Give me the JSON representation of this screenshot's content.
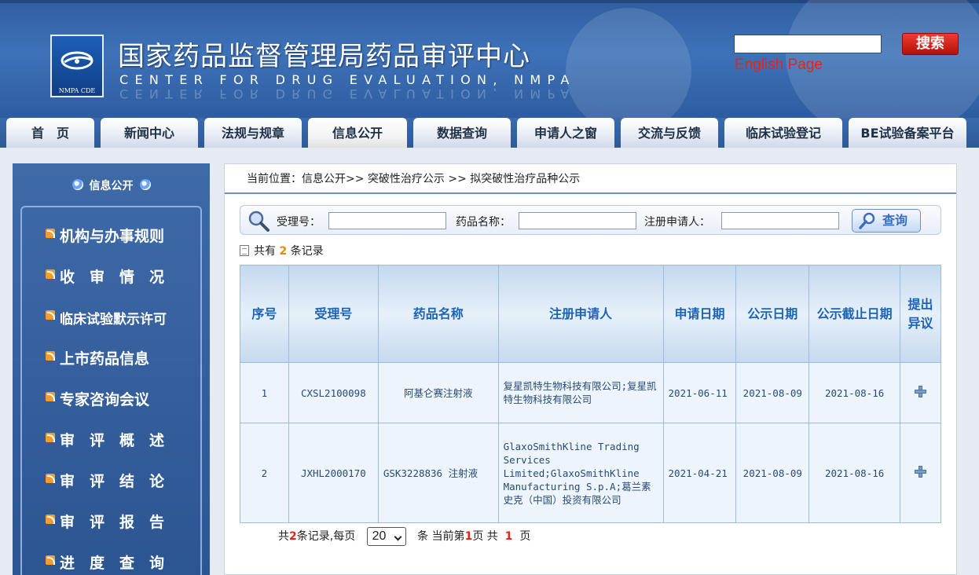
{
  "header": {
    "title": "国家药品监督管理局药品审评中心",
    "subtitle": "CENTER FOR DRUG EVALUATION, NMPA",
    "logo_caption": "NMPA CDE",
    "search_button": "搜索",
    "english_link": "English Page"
  },
  "nav": {
    "tabs": [
      {
        "label": "首　页"
      },
      {
        "label": "新闻中心"
      },
      {
        "label": "法规与规章"
      },
      {
        "label": "信息公开",
        "active": true
      },
      {
        "label": "数据查询"
      },
      {
        "label": "申请人之窗"
      },
      {
        "label": "交流与反馈"
      },
      {
        "label": "临床试验登记"
      },
      {
        "label": "BE试验备案平台"
      }
    ]
  },
  "sidebar": {
    "title": "信息公开",
    "items": [
      {
        "label": "机构与办事规则"
      },
      {
        "label": "收　审　情　况"
      },
      {
        "label": "临床试验默示许可"
      },
      {
        "label": "上市药品信息"
      },
      {
        "label": "专家咨询会议"
      },
      {
        "label": "审　评　概　述"
      },
      {
        "label": "审　评　结　论"
      },
      {
        "label": "审　评　报　告"
      },
      {
        "label": "进　度　查　询"
      }
    ]
  },
  "main": {
    "breadcrumb": "当前位置：信息公开>> 突破性治疗公示 >> 拟突破性治疗品种公示",
    "filters": {
      "acceptance_no_label": "受理号：",
      "drug_name_label": "药品名称：",
      "applicant_label": "注册申请人：",
      "acceptance_no_value": "",
      "drug_name_value": "",
      "applicant_value": "",
      "query_button": "查询"
    },
    "record_count": {
      "prefix": "共有",
      "count": "2",
      "suffix": "条记录"
    },
    "table": {
      "columns": [
        "序号",
        "受理号",
        "药品名称",
        "注册申请人",
        "申请日期",
        "公示日期",
        "公示截止日期",
        "提出异议"
      ],
      "rows": [
        {
          "no": "1",
          "acceptance_no": "CXSL2100098",
          "drug_name": "阿基仑赛注射液",
          "applicant": "复星凯特生物科技有限公司;复星凯特生物科技有限公司",
          "apply_date": "2021-06-11",
          "publish_date": "2021-08-09",
          "deadline": "2021-08-16"
        },
        {
          "no": "2",
          "acceptance_no": "JXHL2000170",
          "drug_name": "GSK3228836 注射液",
          "applicant": "GlaxoSmithKline Trading Services Limited;GlaxoSmithKline Manufacturing S.p.A;葛兰素史克（中国）投资有限公司",
          "apply_date": "2021-04-21",
          "publish_date": "2021-08-09",
          "deadline": "2021-08-16"
        }
      ]
    },
    "pagination": {
      "total_prefix": "共",
      "total": "2",
      "total_suffix": "条记录,每页",
      "page_size": "20",
      "current_prefix": "条 当前第",
      "current": "1",
      "pages_prefix": "页 共",
      "pages": "1",
      "pages_suffix": "页"
    }
  },
  "colors": {
    "header_blue": "#3e72b8",
    "sidebar_blue": "#3f6aa8",
    "table_header_text": "#1c63b7",
    "search_red": "#d0261c",
    "highlight_orange": "#e28a00"
  }
}
